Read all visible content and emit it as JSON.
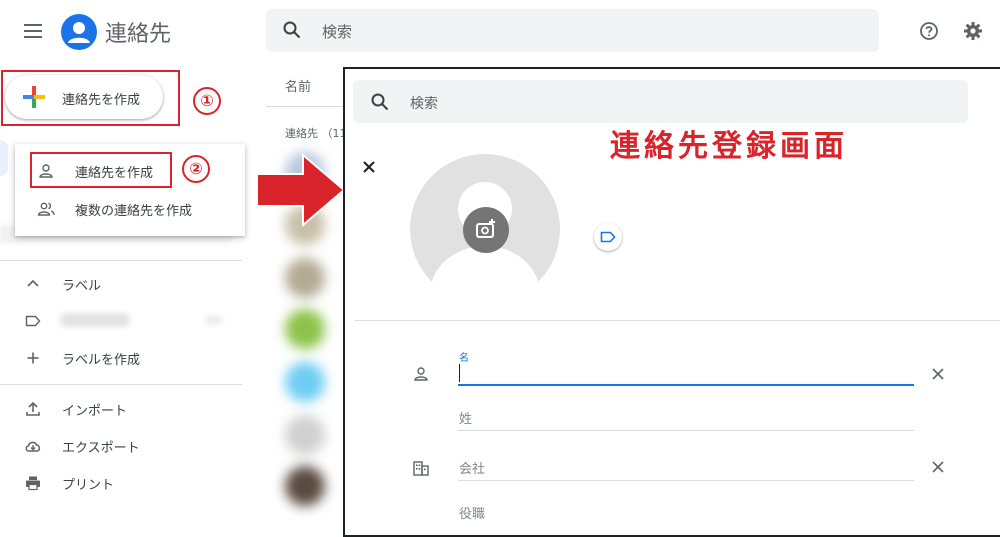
{
  "header": {
    "app_title": "連絡先",
    "search_placeholder": "検索",
    "icons": [
      "menu-icon",
      "contacts-logo-icon",
      "search-icon",
      "help-icon",
      "settings-icon"
    ]
  },
  "sidebar": {
    "create_button_label": "連絡先を作成",
    "dropdown": [
      {
        "label": "連絡先を作成",
        "icon": "person-outline-icon"
      },
      {
        "label": "複数の連絡先を作成",
        "icon": "people-outline-icon"
      }
    ],
    "labels_section": {
      "header": "ラベル",
      "create_label": "ラベルを作成"
    },
    "tools": [
      {
        "label": "インポート",
        "icon": "upload-icon"
      },
      {
        "label": "エクスポート",
        "icon": "cloud-download-icon"
      },
      {
        "label": "プリント",
        "icon": "printer-icon"
      }
    ]
  },
  "annotations": {
    "step1": "①",
    "step2": "②",
    "dialog_caption": "連絡先登録画面"
  },
  "contact_list": {
    "column_name": "名前",
    "count_label": "連絡先 （11"
  },
  "dialog": {
    "search_placeholder": "検索",
    "fields": {
      "first_name_label": "名",
      "last_name_placeholder": "姓",
      "company_placeholder": "会社",
      "job_title_placeholder": "役職"
    }
  },
  "colors": {
    "accent_blue": "#1a73e8",
    "annotation_red": "#d9242c",
    "search_bg": "#f1f3f4",
    "avatar_bg": "#e1e1e1"
  }
}
